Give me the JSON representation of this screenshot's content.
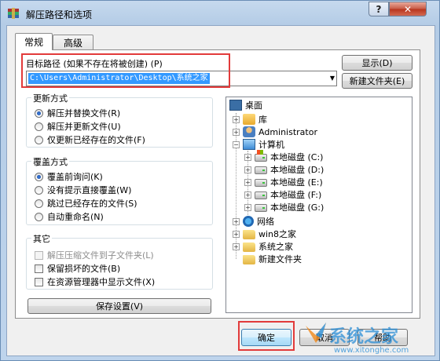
{
  "window": {
    "title": "解压路径和选项",
    "help_glyph": "?",
    "close_glyph": "✕"
  },
  "tabs": [
    {
      "label": "常规",
      "active": true
    },
    {
      "label": "高级",
      "active": false
    }
  ],
  "target_path": {
    "label": "目标路径 (如果不存在将被创建) (P)",
    "value": "C:\\Users\\Administrator\\Desktop\\系统之家"
  },
  "buttons": {
    "show": "显示(D)",
    "new_folder": "新建文件夹(E)",
    "save_settings": "保存设置(V)",
    "ok": "确定",
    "cancel": "取消",
    "help": "帮助"
  },
  "update_mode": {
    "title": "更新方式",
    "options": [
      {
        "label": "解压并替换文件(R)",
        "selected": true
      },
      {
        "label": "解压并更新文件(U)",
        "selected": false
      },
      {
        "label": "仅更新已经存在的文件(F)",
        "selected": false
      }
    ]
  },
  "overwrite_mode": {
    "title": "覆盖方式",
    "options": [
      {
        "label": "覆盖前询问(K)",
        "selected": true
      },
      {
        "label": "没有提示直接覆盖(W)",
        "selected": false
      },
      {
        "label": "跳过已经存在的文件(S)",
        "selected": false
      },
      {
        "label": "自动重命名(N)",
        "selected": false
      }
    ]
  },
  "misc": {
    "title": "其它",
    "options": [
      {
        "label": "解压压缩文件到子文件夹(L)",
        "checked": false,
        "disabled": true
      },
      {
        "label": "保留损坏的文件(B)",
        "checked": false,
        "disabled": false
      },
      {
        "label": "在资源管理器中显示文件(X)",
        "checked": false,
        "disabled": false
      }
    ]
  },
  "tree": {
    "desktop": "桌面",
    "library": "库",
    "user": "Administrator",
    "computer": "计算机",
    "drives": [
      "本地磁盘 (C:)",
      "本地磁盘 (D:)",
      "本地磁盘 (E:)",
      "本地磁盘 (F:)",
      "本地磁盘 (G:)"
    ],
    "network": "网络",
    "folders": [
      "win8之家",
      "系统之家",
      "新建文件夹"
    ]
  },
  "watermark": {
    "text": "系统之家",
    "url": "www.xitonghe.com"
  },
  "colors": {
    "highlight": "#3399ff",
    "annotation_red": "#e23b3b"
  }
}
